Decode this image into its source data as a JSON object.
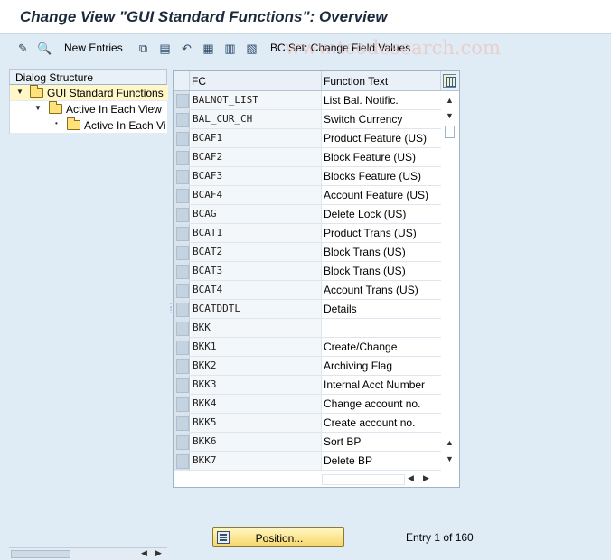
{
  "window": {
    "title": "Change View \"GUI Standard Functions\": Overview"
  },
  "toolbar": {
    "new_entries_label": "New Entries",
    "bc_set_label": "BC Set: Change Field Values",
    "watermark": "www.tcodesearch.com"
  },
  "dialog_structure": {
    "header": "Dialog Structure",
    "nodes": [
      {
        "label": "GUI Standard Functions",
        "selected": true
      },
      {
        "label": "Active In Each View"
      },
      {
        "label": "Active In Each Vi"
      }
    ]
  },
  "table": {
    "columns": [
      "FC",
      "Function Text"
    ],
    "rows": [
      {
        "fc": "BALNOT_LIST",
        "text": "List Bal. Notific."
      },
      {
        "fc": "BAL_CUR_CH",
        "text": "Switch Currency"
      },
      {
        "fc": "BCAF1",
        "text": "Product Feature (US)"
      },
      {
        "fc": "BCAF2",
        "text": "Block Feature (US)"
      },
      {
        "fc": "BCAF3",
        "text": "Blocks Feature (US)"
      },
      {
        "fc": "BCAF4",
        "text": "Account Feature (US)"
      },
      {
        "fc": "BCAG",
        "text": "Delete Lock (US)"
      },
      {
        "fc": "BCAT1",
        "text": "Product Trans (US)"
      },
      {
        "fc": "BCAT2",
        "text": "Block Trans (US)"
      },
      {
        "fc": "BCAT3",
        "text": "Block Trans (US)"
      },
      {
        "fc": "BCAT4",
        "text": "Account Trans (US)"
      },
      {
        "fc": "BCATDDTL",
        "text": "Details"
      },
      {
        "fc": "BKK",
        "text": ""
      },
      {
        "fc": "BKK1",
        "text": "Create/Change"
      },
      {
        "fc": "BKK2",
        "text": "Archiving Flag"
      },
      {
        "fc": "BKK3",
        "text": "Internal Acct Number"
      },
      {
        "fc": "BKK4",
        "text": "Change account no."
      },
      {
        "fc": "BKK5",
        "text": "Create account no."
      },
      {
        "fc": "BKK6",
        "text": "Sort BP"
      },
      {
        "fc": "BKK7",
        "text": "Delete BP"
      }
    ]
  },
  "footer": {
    "position_button": "Position...",
    "entry_info": "Entry 1 of 160"
  },
  "colors": {
    "background": "#dfebf5",
    "selected_node": "#fff7c8",
    "button": "#f6d66a"
  }
}
